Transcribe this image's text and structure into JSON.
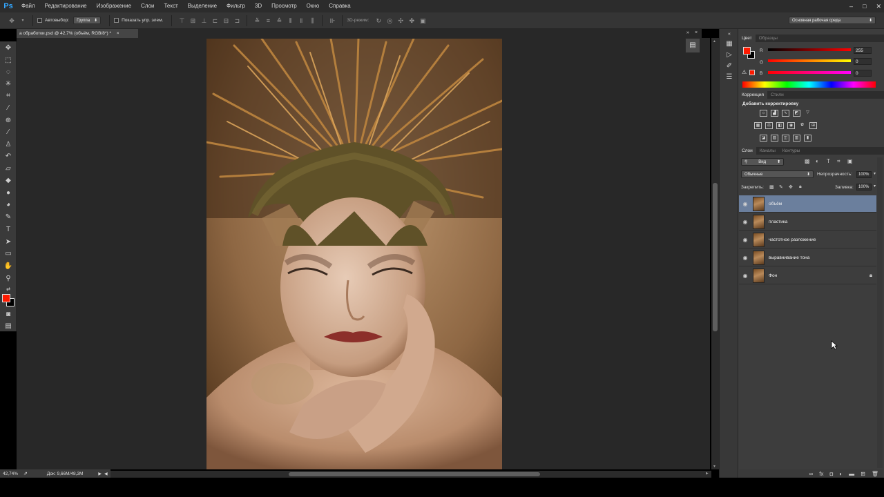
{
  "app": {
    "logo": "Ps",
    "menu": [
      "Файл",
      "Редактирование",
      "Изображение",
      "Слои",
      "Текст",
      "Выделение",
      "Фильтр",
      "3D",
      "Просмотр",
      "Окно",
      "Справка"
    ],
    "window_controls": [
      "–",
      "□",
      "✕"
    ]
  },
  "options": {
    "autoselect_label": "Автовыбор:",
    "autoselect_value": "Группа",
    "show_transform_label": "Показать упр. элем.",
    "mode3d_label": "3D-режим:",
    "workspace": "Основная рабочая среда"
  },
  "document": {
    "tab_title": "а обработки.psd @ 42,7% (объём, RGB/8*) *",
    "close": "×"
  },
  "status": {
    "zoom": "42,74%",
    "doc_size": "Док: 9,66M/48,3M"
  },
  "color_panel": {
    "tabs": [
      "Цвет",
      "Образцы"
    ],
    "channels": [
      {
        "label": "R",
        "value": "255"
      },
      {
        "label": "G",
        "value": "0"
      },
      {
        "label": "B",
        "value": "0"
      }
    ],
    "foreground": "#ff1a00"
  },
  "adjustments_panel": {
    "tabs": [
      "Коррекция",
      "Стили"
    ],
    "heading": "Добавить корректировку"
  },
  "layers_panel": {
    "tabs": [
      "Слои",
      "Каналы",
      "Контуры"
    ],
    "filter": "Вид",
    "blend_mode": "Обычные",
    "opacity_label": "Непрозрачность:",
    "opacity": "100%",
    "lock_label": "Закрепить:",
    "fill_label": "Заливка:",
    "fill": "100%",
    "layers": [
      {
        "name": "объём",
        "selected": true,
        "locked": false
      },
      {
        "name": "пластика",
        "selected": false,
        "locked": false
      },
      {
        "name": "частотное разложение",
        "selected": false,
        "locked": false
      },
      {
        "name": "выравнивание тона",
        "selected": false,
        "locked": false
      },
      {
        "name": "Фон",
        "selected": false,
        "locked": true
      }
    ]
  }
}
